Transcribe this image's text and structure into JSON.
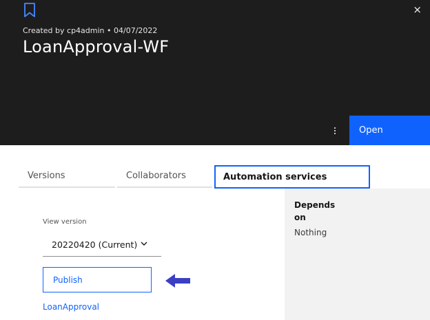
{
  "header": {
    "created": "Created by cp4admin • 04/07/2022",
    "title": "LoanApproval-WF",
    "open_label": "Open",
    "close_glyph": "×",
    "background": "#1e1d1e",
    "accent": "#0f62fe"
  },
  "tabs": [
    {
      "label": "Versions",
      "selected": false
    },
    {
      "label": "Collaborators",
      "selected": false
    },
    {
      "label": "Automation services",
      "selected": true
    }
  ],
  "main": {
    "view_version_label": "View version",
    "selected_version": "20220420 (Current)",
    "publish_label": "Publish",
    "link_label": "LoanApproval"
  },
  "side_panel": {
    "heading": "Depends on",
    "value": "Nothing"
  },
  "icons": [
    "bookmark-icon",
    "close-icon",
    "overflow-menu-icon",
    "chevron-down-icon",
    "arrow-left-icon"
  ],
  "annotation_color": "#3b3fc4"
}
